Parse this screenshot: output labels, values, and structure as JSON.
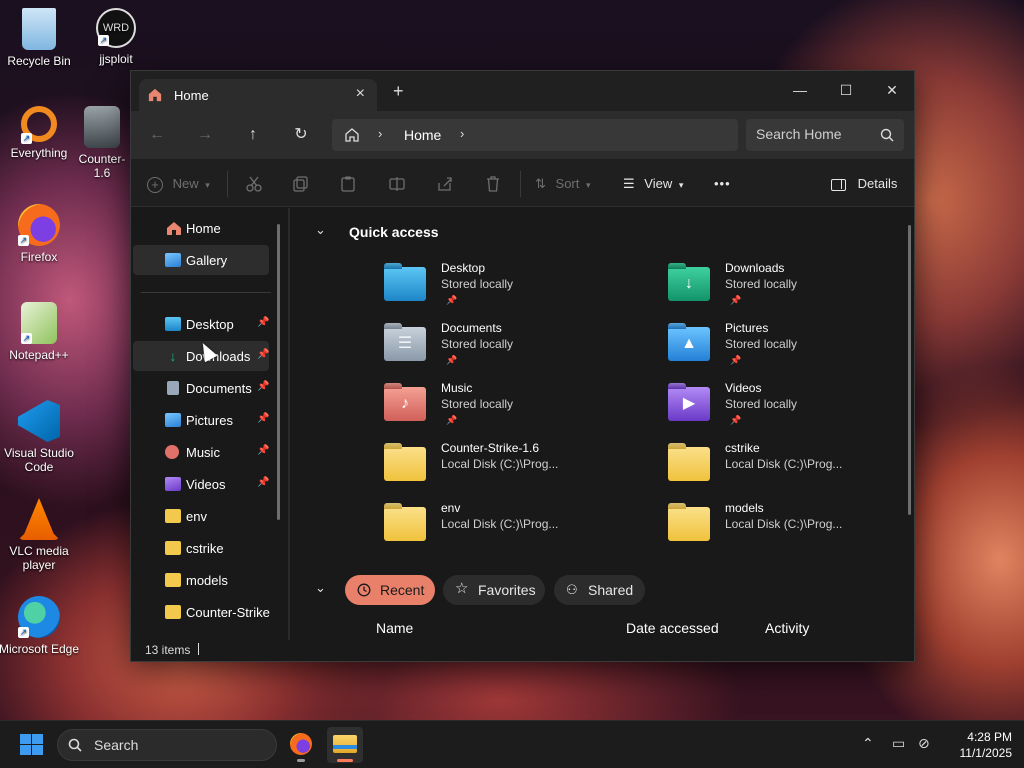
{
  "desktop": {
    "icons": [
      {
        "label": "Recycle Bin",
        "icon": "recycle-bin-icon"
      },
      {
        "label": "jjsploit",
        "icon": "jjsploit-icon"
      },
      {
        "label": "Everything",
        "icon": "everything-search-icon"
      },
      {
        "label": "Counter-\n1.6",
        "icon": "counter-strike-icon"
      },
      {
        "label": "Firefox",
        "icon": "firefox-icon"
      },
      {
        "label": "Notepad++",
        "icon": "notepad-plus-plus-icon"
      },
      {
        "label": "Visual Studio Code",
        "icon": "vscode-icon"
      },
      {
        "label": "VLC media player",
        "icon": "vlc-icon"
      },
      {
        "label": "Microsoft Edge",
        "icon": "edge-icon"
      }
    ]
  },
  "window": {
    "tab_title": "Home",
    "new_tab": "+",
    "controls": {
      "minimize": "—",
      "maximize": "☐",
      "close": "✕"
    },
    "breadcrumb": "Home",
    "search_placeholder": "Search Home"
  },
  "command_bar": {
    "new_label": "New",
    "sort_label": "Sort",
    "view_label": "View",
    "more_label": "•••",
    "details_label": "Details"
  },
  "sidebar": {
    "items": [
      {
        "label": "Home",
        "icon": "home-icon",
        "color": "#e8866f",
        "pinned": false
      },
      {
        "label": "Gallery",
        "icon": "gallery-icon",
        "color": "#3aa0e8",
        "pinned": false
      },
      {
        "label": "Desktop",
        "icon": "desktop-icon",
        "color": "#2fa0d8",
        "pinned": true
      },
      {
        "label": "Downloads",
        "icon": "downloads-icon",
        "color": "#19b07a",
        "pinned": true
      },
      {
        "label": "Documents",
        "icon": "documents-icon",
        "color": "#9aa7b8",
        "pinned": true
      },
      {
        "label": "Pictures",
        "icon": "pictures-icon",
        "color": "#3aa6ee",
        "pinned": true
      },
      {
        "label": "Music",
        "icon": "music-icon",
        "color": "#e0706a",
        "pinned": true
      },
      {
        "label": "Videos",
        "icon": "videos-icon",
        "color": "#8a5ae0",
        "pinned": true
      },
      {
        "label": "env",
        "icon": "folder-icon",
        "color": "#f2c94c",
        "pinned": false
      },
      {
        "label": "cstrike",
        "icon": "folder-icon",
        "color": "#f2c94c",
        "pinned": false
      },
      {
        "label": "models",
        "icon": "folder-icon",
        "color": "#f2c94c",
        "pinned": false
      },
      {
        "label": "Counter-Strike-",
        "icon": "folder-icon",
        "color": "#f2c94c",
        "pinned": false
      }
    ],
    "pin_glyph": "📌"
  },
  "quick_access": {
    "heading": "Quick access",
    "items": [
      {
        "name": "Desktop",
        "sub": "Stored locally",
        "pinned": true,
        "color": "#2b9be0",
        "icon": "desktop-folder-icon"
      },
      {
        "name": "Downloads",
        "sub": "Stored locally",
        "pinned": true,
        "color": "#1fae84",
        "icon": "downloads-folder-icon"
      },
      {
        "name": "Documents",
        "sub": "Stored locally",
        "pinned": true,
        "color": "#9aa7b8",
        "icon": "documents-folder-icon"
      },
      {
        "name": "Pictures",
        "sub": "Stored locally",
        "pinned": true,
        "color": "#3aa6ee",
        "icon": "pictures-folder-icon"
      },
      {
        "name": "Music",
        "sub": "Stored locally",
        "pinned": true,
        "color": "#e07a6a",
        "icon": "music-folder-icon"
      },
      {
        "name": "Videos",
        "sub": "Stored locally",
        "pinned": true,
        "color": "#8a5ae0",
        "icon": "videos-folder-icon"
      },
      {
        "name": "Counter-Strike-1.6",
        "sub": "Local Disk (C:)\\Prog...",
        "pinned": false,
        "color": "#f2c94c",
        "icon": "folder-icon"
      },
      {
        "name": "cstrike",
        "sub": "Local Disk (C:)\\Prog...",
        "pinned": false,
        "color": "#f2c94c",
        "icon": "folder-icon"
      },
      {
        "name": "env",
        "sub": "Local Disk (C:)\\Prog...",
        "pinned": false,
        "color": "#f2c94c",
        "icon": "folder-icon"
      },
      {
        "name": "models",
        "sub": "Local Disk (C:)\\Prog...",
        "pinned": false,
        "color": "#f2c94c",
        "icon": "folder-icon"
      }
    ]
  },
  "recent_section": {
    "pills": [
      {
        "label": "Recent",
        "icon": "clock-icon",
        "active": true
      },
      {
        "label": "Favorites",
        "icon": "star-icon",
        "active": false
      },
      {
        "label": "Shared",
        "icon": "people-icon",
        "active": false
      }
    ],
    "columns": [
      "Name",
      "Date accessed",
      "Activity"
    ]
  },
  "status": {
    "count": "13 items"
  },
  "taskbar": {
    "search_placeholder": "Search",
    "time": "4:28 PM",
    "date": "11/1/2025",
    "accent": "#ff7a59"
  }
}
